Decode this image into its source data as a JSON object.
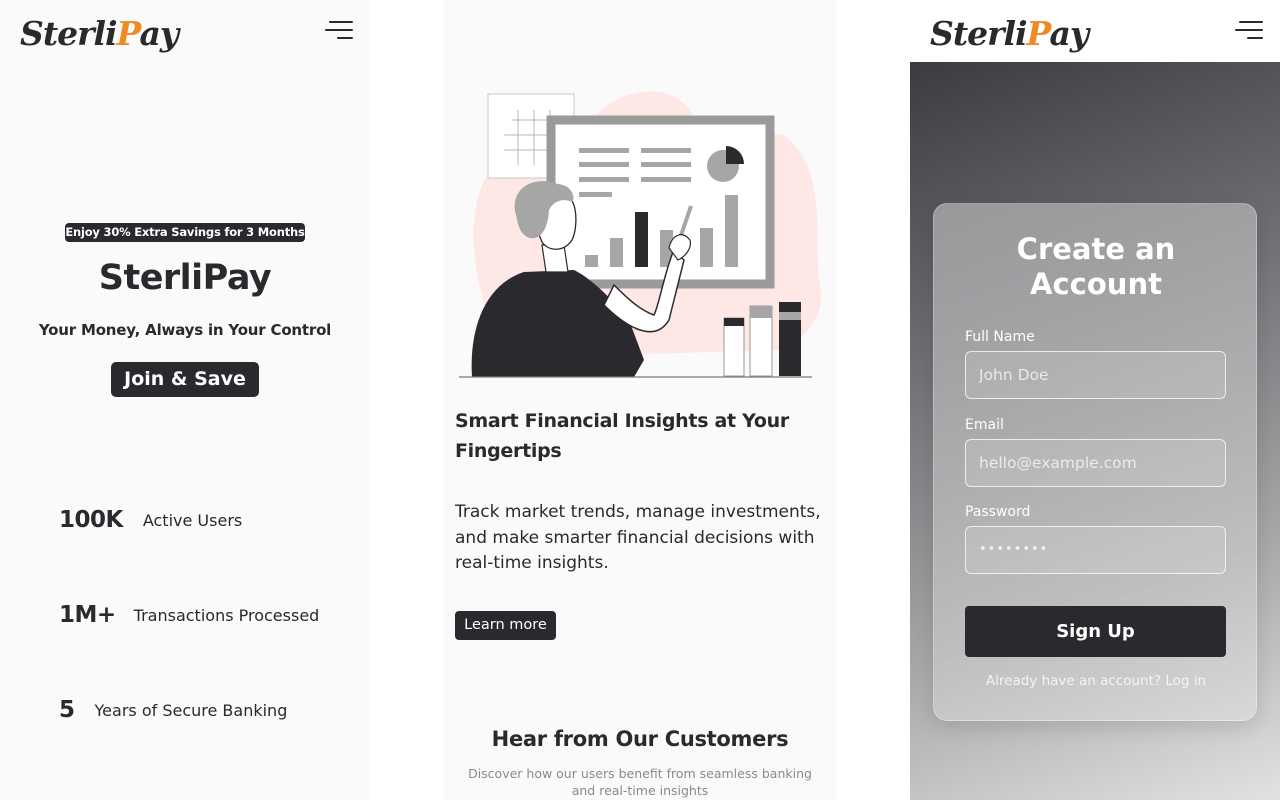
{
  "brand": {
    "logo_main": "Sterli",
    "logo_accent": "P",
    "logo_tail": "ay",
    "accent_color": "#f08a24",
    "dark_color": "#2a2a2e"
  },
  "hero": {
    "promo_badge": "Enjoy 30% Extra Savings for 3 Months",
    "title": "SterliPay",
    "subtitle": "Your Money, Always in Your Control",
    "cta": "Join & Save"
  },
  "stats": [
    {
      "value": "100K",
      "label": "Active Users"
    },
    {
      "value": "1M+",
      "label": "Transactions Processed"
    },
    {
      "value": "5",
      "label": "Years of Secure Banking"
    }
  ],
  "feature": {
    "title": "Smart Financial Insights at Your Fingertips",
    "body": "Track market trends, manage investments, and make smarter financial decisions with real-time insights.",
    "cta": "Learn more",
    "illustration_icon": "person-presenting-chart-illustration"
  },
  "testimonials": {
    "title": "Hear from Our Customers",
    "subtitle": "Discover how our users benefit from seamless banking and real-time insights"
  },
  "signup": {
    "title": "Create an Account",
    "full_name_label": "Full Name",
    "full_name_placeholder": "John Doe",
    "email_label": "Email",
    "email_placeholder": "hello@example.com",
    "password_label": "Password",
    "password_value": "••••••••",
    "submit": "Sign Up",
    "login_prompt": "Already have an account?",
    "login_link": "Log in"
  },
  "icons": {
    "menu": "hamburger-menu-icon"
  }
}
